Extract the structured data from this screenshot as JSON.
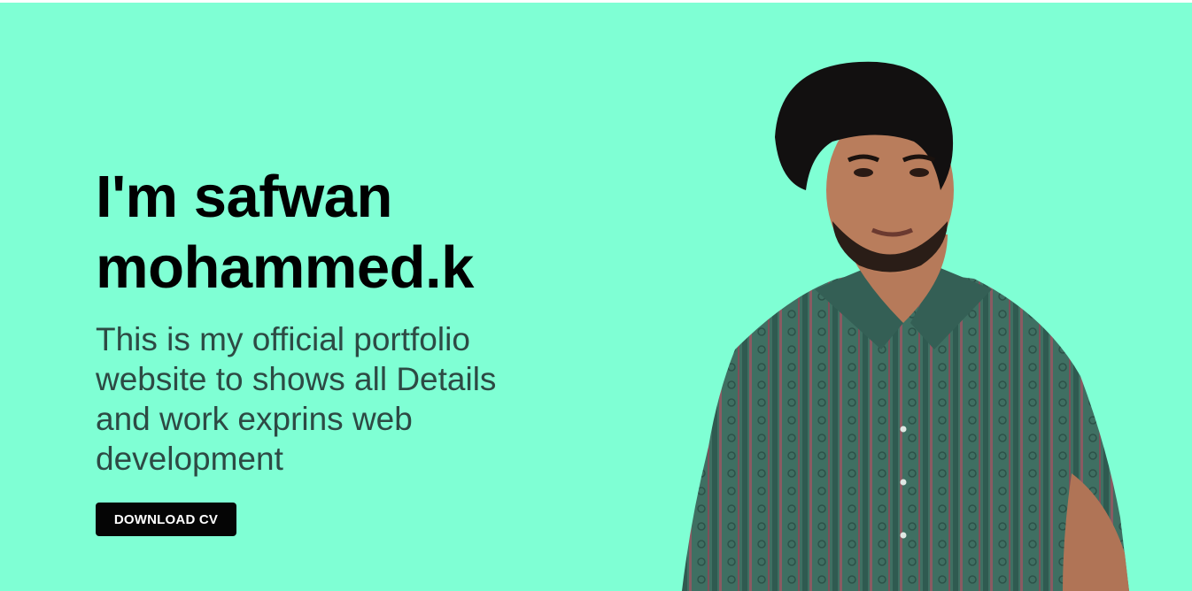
{
  "hero": {
    "title_line1": "I'm safwan",
    "title_line2": "mohammed.k",
    "subtitle": "This is my official portfolio website to shows all Details and work exprins web development",
    "cta_label": "DOWNLOAD CV"
  },
  "portrait": {
    "alt": "portrait photo"
  },
  "colors": {
    "background": "#7fffd4",
    "button": "#050505",
    "button_text": "#ffffff",
    "title": "#000000",
    "subtitle": "#2d4a44"
  }
}
